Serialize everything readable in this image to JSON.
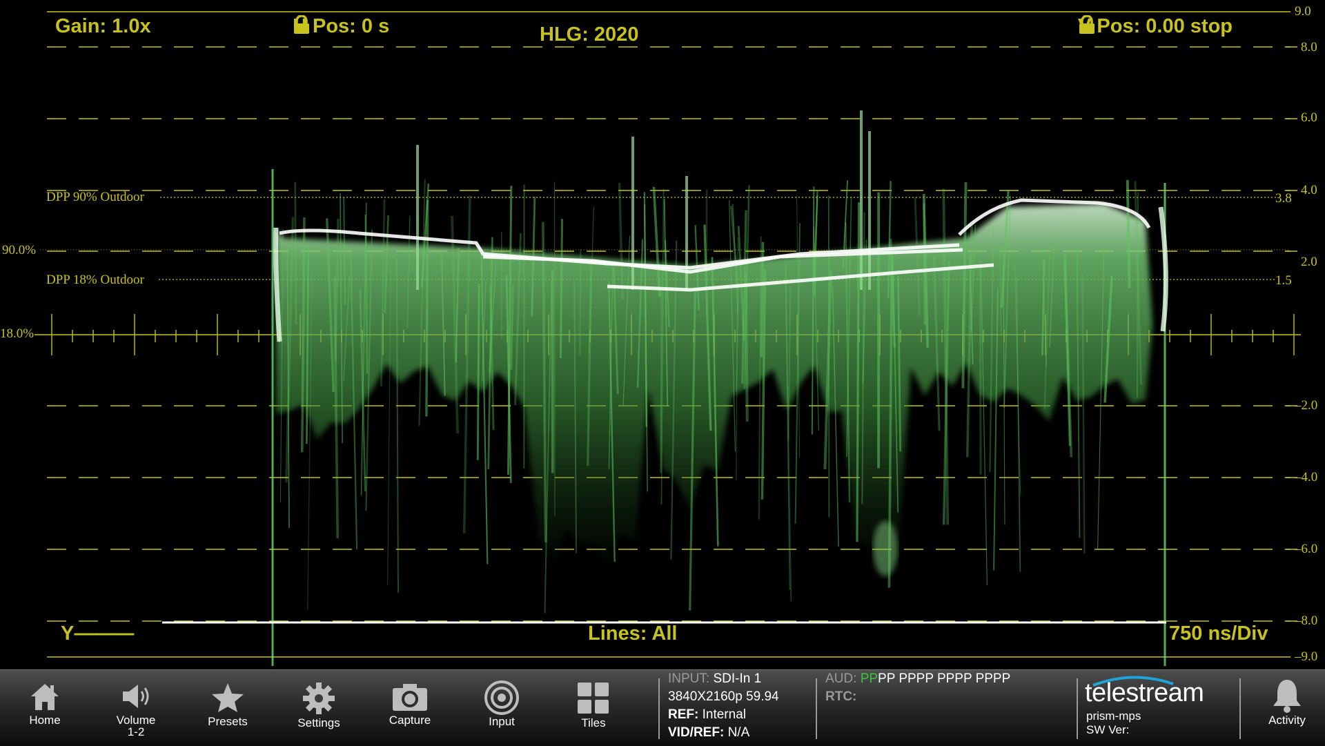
{
  "scope": {
    "gain_label": "Gain: 1.0x",
    "hpos_label": "H Pos: 0 s",
    "mode_label": "HLG: 2020",
    "vpos_label": "V Pos: 0.00 stop",
    "trace_label": "Y———",
    "lines_label": "Lines: All",
    "sweep_label": "750 ns/Div",
    "right_scale": [
      "9.0",
      "8.0",
      "6.0",
      "4.0",
      "2.0",
      "–2.0",
      "–4.0",
      "–6.0",
      "–8.0",
      "–9.0"
    ],
    "ref_lines": [
      {
        "name": "DPP 90% Outdoor",
        "value": "3.8"
      },
      {
        "name": "DPP 18% Outdoor",
        "value": "1.5"
      }
    ],
    "left_markers": [
      "90.0%",
      "18.0%"
    ],
    "colors": {
      "graticule": "#c8c21e",
      "trace": "#6fd56f",
      "trace_peak": "#ffffff"
    }
  },
  "toolbar": {
    "buttons": [
      {
        "label": "Home",
        "icon": "home-icon"
      },
      {
        "label": "Volume\n1-2",
        "icon": "speaker-icon"
      },
      {
        "label": "Presets",
        "icon": "star-icon"
      },
      {
        "label": "Settings",
        "icon": "gear-icon"
      },
      {
        "label": "Capture",
        "icon": "camera-icon"
      },
      {
        "label": "Input",
        "icon": "input-target-icon"
      },
      {
        "label": "Tiles",
        "icon": "tiles-icon"
      }
    ],
    "input": {
      "input_key": "INPUT:",
      "input_val": "SDI-In 1",
      "format": "3840X2160p 59.94",
      "ref_key": "REF:",
      "ref_val": "Internal",
      "vidref_key": "VID/REF:",
      "vidref_val": "N/A"
    },
    "audio": {
      "aud_key": "AUD:",
      "aud_green": "PP",
      "aud_rest": "PP PPPP PPPP PPPP",
      "rtc_key": "RTC:"
    },
    "brand": {
      "name": "telestream",
      "model": "prism-mps",
      "sw_key": "SW Ver:"
    },
    "activity": {
      "label": "Activity",
      "icon": "bell-icon"
    }
  }
}
